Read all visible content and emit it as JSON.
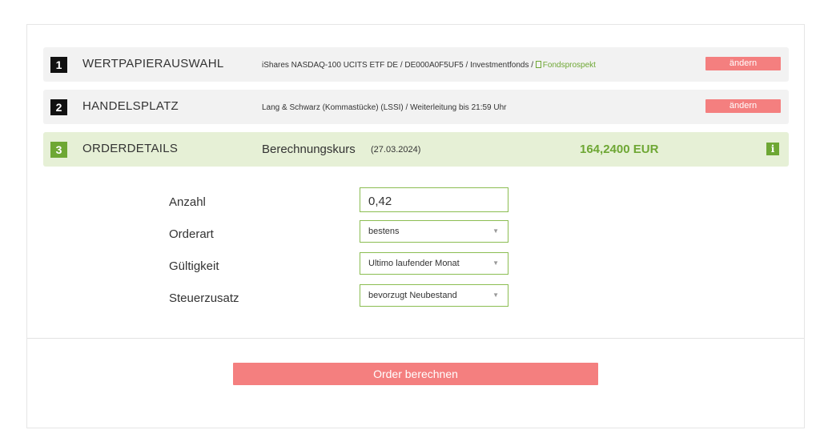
{
  "steps": [
    {
      "number": "1",
      "title": "WERTPAPIERAUSWAHL",
      "info": "iShares NASDAQ-100 UCITS ETF DE / DE000A0F5UF5 / Investmentfonds / ",
      "link": "Fondsprospekt",
      "button": "ändern"
    },
    {
      "number": "2",
      "title": "HANDELSPLATZ",
      "info": "Lang & Schwarz (Kommastücke) (LSSI) / Weiterleitung bis 21:59 Uhr",
      "button": "ändern"
    },
    {
      "number": "3",
      "title": "ORDERDETAILS",
      "calc_label": "Berechnungskurs",
      "calc_date": "(27.03.2024)",
      "price": "164,2400 EUR",
      "info_icon": "i"
    }
  ],
  "form": {
    "quantity_label": "Anzahl",
    "quantity_value": "0,42",
    "order_type_label": "Orderart",
    "order_type_value": "bestens",
    "validity_label": "Gültigkeit",
    "validity_value": "Ultimo laufender Monat",
    "tax_label": "Steuerzusatz",
    "tax_value": "bevorzugt Neubestand",
    "dropdown_arrow": "▼"
  },
  "submit_label": "Order berechnen",
  "colors": {
    "accent_green": "#6ea734",
    "button_red": "#f47f7f",
    "active_bg": "#e6f0d6"
  }
}
